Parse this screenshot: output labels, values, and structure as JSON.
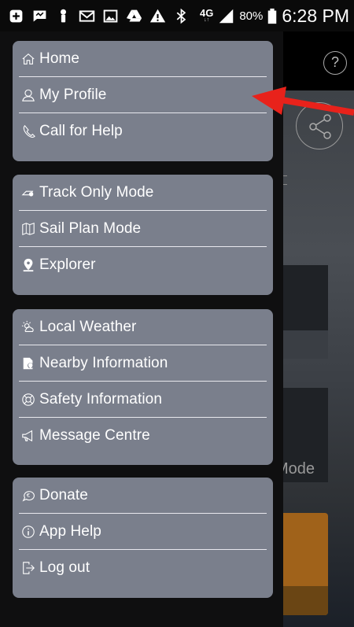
{
  "status_bar": {
    "icons": [
      "add-box-icon",
      "chat-icon",
      "figure-icon",
      "mail-icon",
      "image-icon",
      "drive-icon",
      "warning-icon",
      "bluetooth-icon"
    ],
    "network": "4G",
    "network_sub": "↓↑",
    "battery": "80%",
    "time": "6:28 PM"
  },
  "background_app": {
    "help_symbol": "?",
    "mode_text": "Mode"
  },
  "drawer": {
    "groups": [
      {
        "items": [
          {
            "label": "Home",
            "icon": "home-icon"
          },
          {
            "label": "My Profile",
            "icon": "profile-icon"
          },
          {
            "label": "Call for Help",
            "icon": "phone-help-icon"
          }
        ]
      },
      {
        "items": [
          {
            "label": "Track Only Mode",
            "icon": "track-mode-icon"
          },
          {
            "label": "Sail Plan Mode",
            "icon": "map-icon"
          },
          {
            "label": "Explorer",
            "icon": "location-pin-icon"
          }
        ]
      },
      {
        "items": [
          {
            "label": "Local Weather",
            "icon": "weather-icon"
          },
          {
            "label": "Nearby Information",
            "icon": "nearby-icon"
          },
          {
            "label": "Safety Information",
            "icon": "lifebuoy-icon"
          },
          {
            "label": "Message Centre",
            "icon": "megaphone-icon"
          }
        ]
      },
      {
        "items": [
          {
            "label": "Donate",
            "icon": "donate-icon"
          },
          {
            "label": "App Help",
            "icon": "info-icon"
          },
          {
            "label": "Log out",
            "icon": "logout-icon"
          }
        ]
      }
    ]
  },
  "colors": {
    "drawer_bg": "#0f0f10",
    "group_bg": "#7a7f8c",
    "divider": "#e8e8ee",
    "annotation_arrow": "#e8221b"
  }
}
